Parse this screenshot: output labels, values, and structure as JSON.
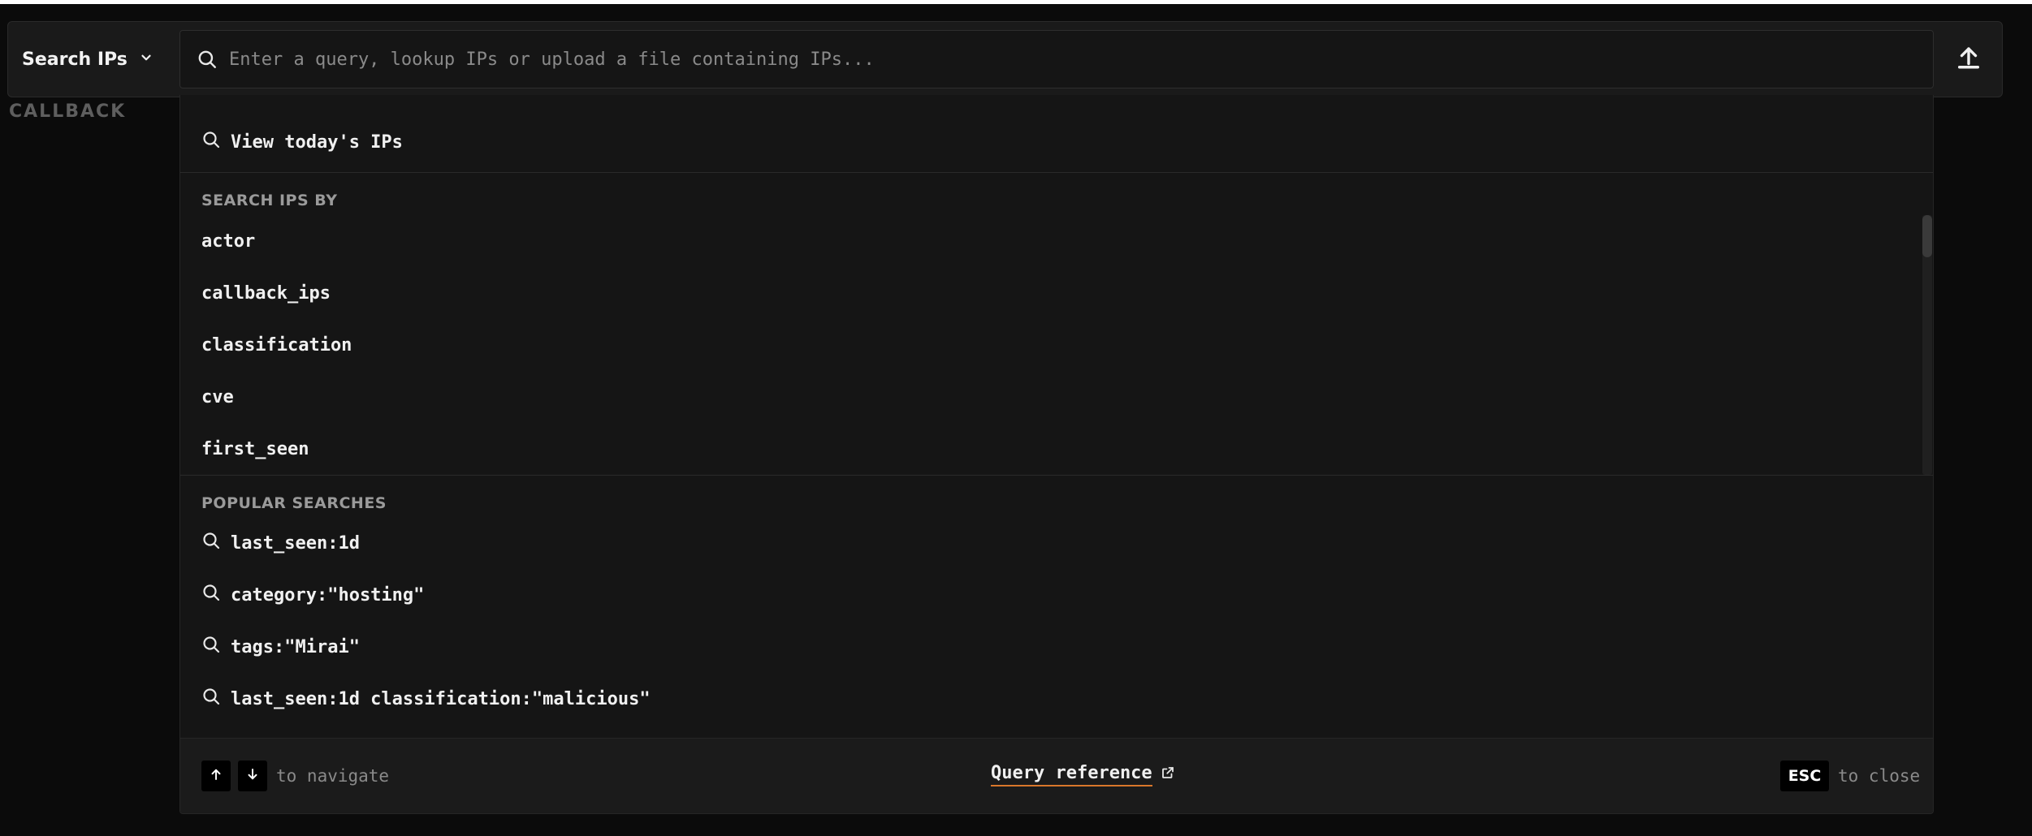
{
  "header": {
    "scope_label": "Search IPs",
    "search_placeholder": "Enter a query, lookup IPs or upload a file containing IPs...",
    "search_value": ""
  },
  "background_label": "CALLBACK",
  "dropdown": {
    "today_label": "View today's IPs",
    "search_by_heading": "SEARCH IPS BY",
    "fields": [
      "actor",
      "callback_ips",
      "classification",
      "cve",
      "first_seen"
    ],
    "popular_heading": "POPULAR SEARCHES",
    "popular": [
      "last_seen:1d",
      "category:\"hosting\"",
      "tags:\"Mirai\"",
      "last_seen:1d classification:\"malicious\""
    ]
  },
  "footer": {
    "navigate_text": "to navigate",
    "query_reference": "Query reference",
    "esc_key": "ESC",
    "close_text": "to close"
  },
  "colors": {
    "background": "#0b0b0b",
    "panel": "#151515",
    "accent_underline": "#d9772b"
  },
  "icons": [
    "chevron-down-icon",
    "search-icon",
    "upload-icon",
    "arrow-up-icon",
    "arrow-down-icon",
    "external-link-icon"
  ]
}
